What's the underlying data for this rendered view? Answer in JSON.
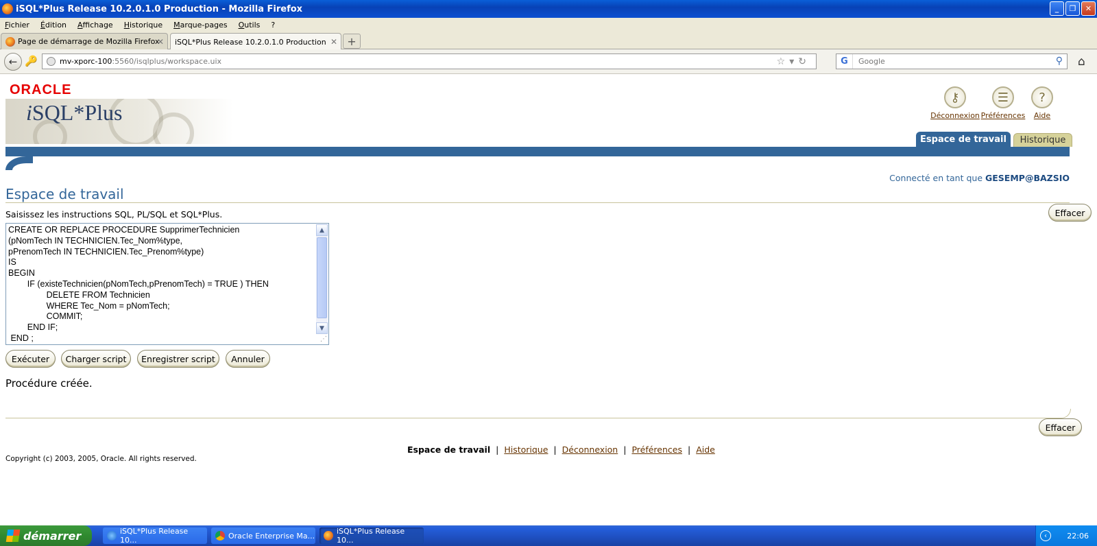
{
  "window": {
    "title": "iSQL*Plus Release 10.2.0.1.0 Production - Mozilla Firefox",
    "controls": {
      "minimize": "_",
      "maximize": "❐",
      "close": "✕"
    }
  },
  "menu": [
    "Fichier",
    "Édition",
    "Affichage",
    "Historique",
    "Marque-pages",
    "Outils",
    "?"
  ],
  "browser_tabs": [
    {
      "label": "Page de démarrage de Mozilla Firefox",
      "active": false
    },
    {
      "label": "iSQL*Plus Release 10.2.0.1.0 Production",
      "active": true
    }
  ],
  "new_tab_label": "+",
  "address": {
    "host": "mv-xporc-100",
    "rest": ":5560/isqlplus/workspace.uix"
  },
  "search": {
    "placeholder": "Google"
  },
  "app": {
    "logo": "ORACLE",
    "product_prefix": "i",
    "product_name": "SQL*Plus",
    "global_buttons": [
      {
        "label": "Déconnexion",
        "icon": "key-icon"
      },
      {
        "label": "Préférences",
        "icon": "preferences-icon"
      },
      {
        "label": "Aide",
        "icon": "help-icon"
      }
    ],
    "tabs": [
      {
        "label": "Espace de travail",
        "active": true
      },
      {
        "label": "Historique",
        "active": false
      }
    ],
    "connected_prefix": "Connecté en tant que",
    "connected_user": "GESEMP@BAZSIO"
  },
  "workspace": {
    "heading": "Espace de travail",
    "instruction": "Saisissez les instructions SQL, PL/SQL et SQL*Plus.",
    "clear_label": "Effacer",
    "sql": "CREATE OR REPLACE PROCEDURE SupprimerTechnicien\n(pNomTech IN TECHNICIEN.Tec_Nom%type,\npPrenomTech IN TECHNICIEN.Tec_Prenom%type)\nIS\nBEGIN\n        IF (existeTechnicien(pNomTech,pPrenomTech) = TRUE ) THEN\n                DELETE FROM Technicien\n                WHERE Tec_Nom = pNomTech;\n                COMMIT;\n        END IF;\n END ;",
    "buttons": {
      "execute": "Exécuter",
      "load": "Charger script",
      "save": "Enregistrer script",
      "cancel": "Annuler"
    },
    "result": "Procédure créée.",
    "clear_bottom_label": "Effacer"
  },
  "footer": {
    "current": "Espace de travail",
    "separator": "|",
    "links": [
      "Historique",
      "Déconnexion",
      "Préférences",
      "Aide"
    ],
    "copyright": "Copyright (c) 2003, 2005, Oracle. All rights reserved."
  },
  "taskbar": {
    "start": "démarrer",
    "tasks": [
      {
        "label": "iSQL*Plus Release 10...",
        "icon": "ie-icon",
        "active": false
      },
      {
        "label": "Oracle Enterprise Ma...",
        "icon": "chrome-icon",
        "active": false
      },
      {
        "label": "iSQL*Plus Release 10...",
        "icon": "firefox-icon",
        "active": true
      }
    ],
    "clock": "22:06"
  },
  "colors": {
    "oracle_blue": "#336699",
    "oracle_red": "#e60000",
    "link_brown": "#663300"
  }
}
